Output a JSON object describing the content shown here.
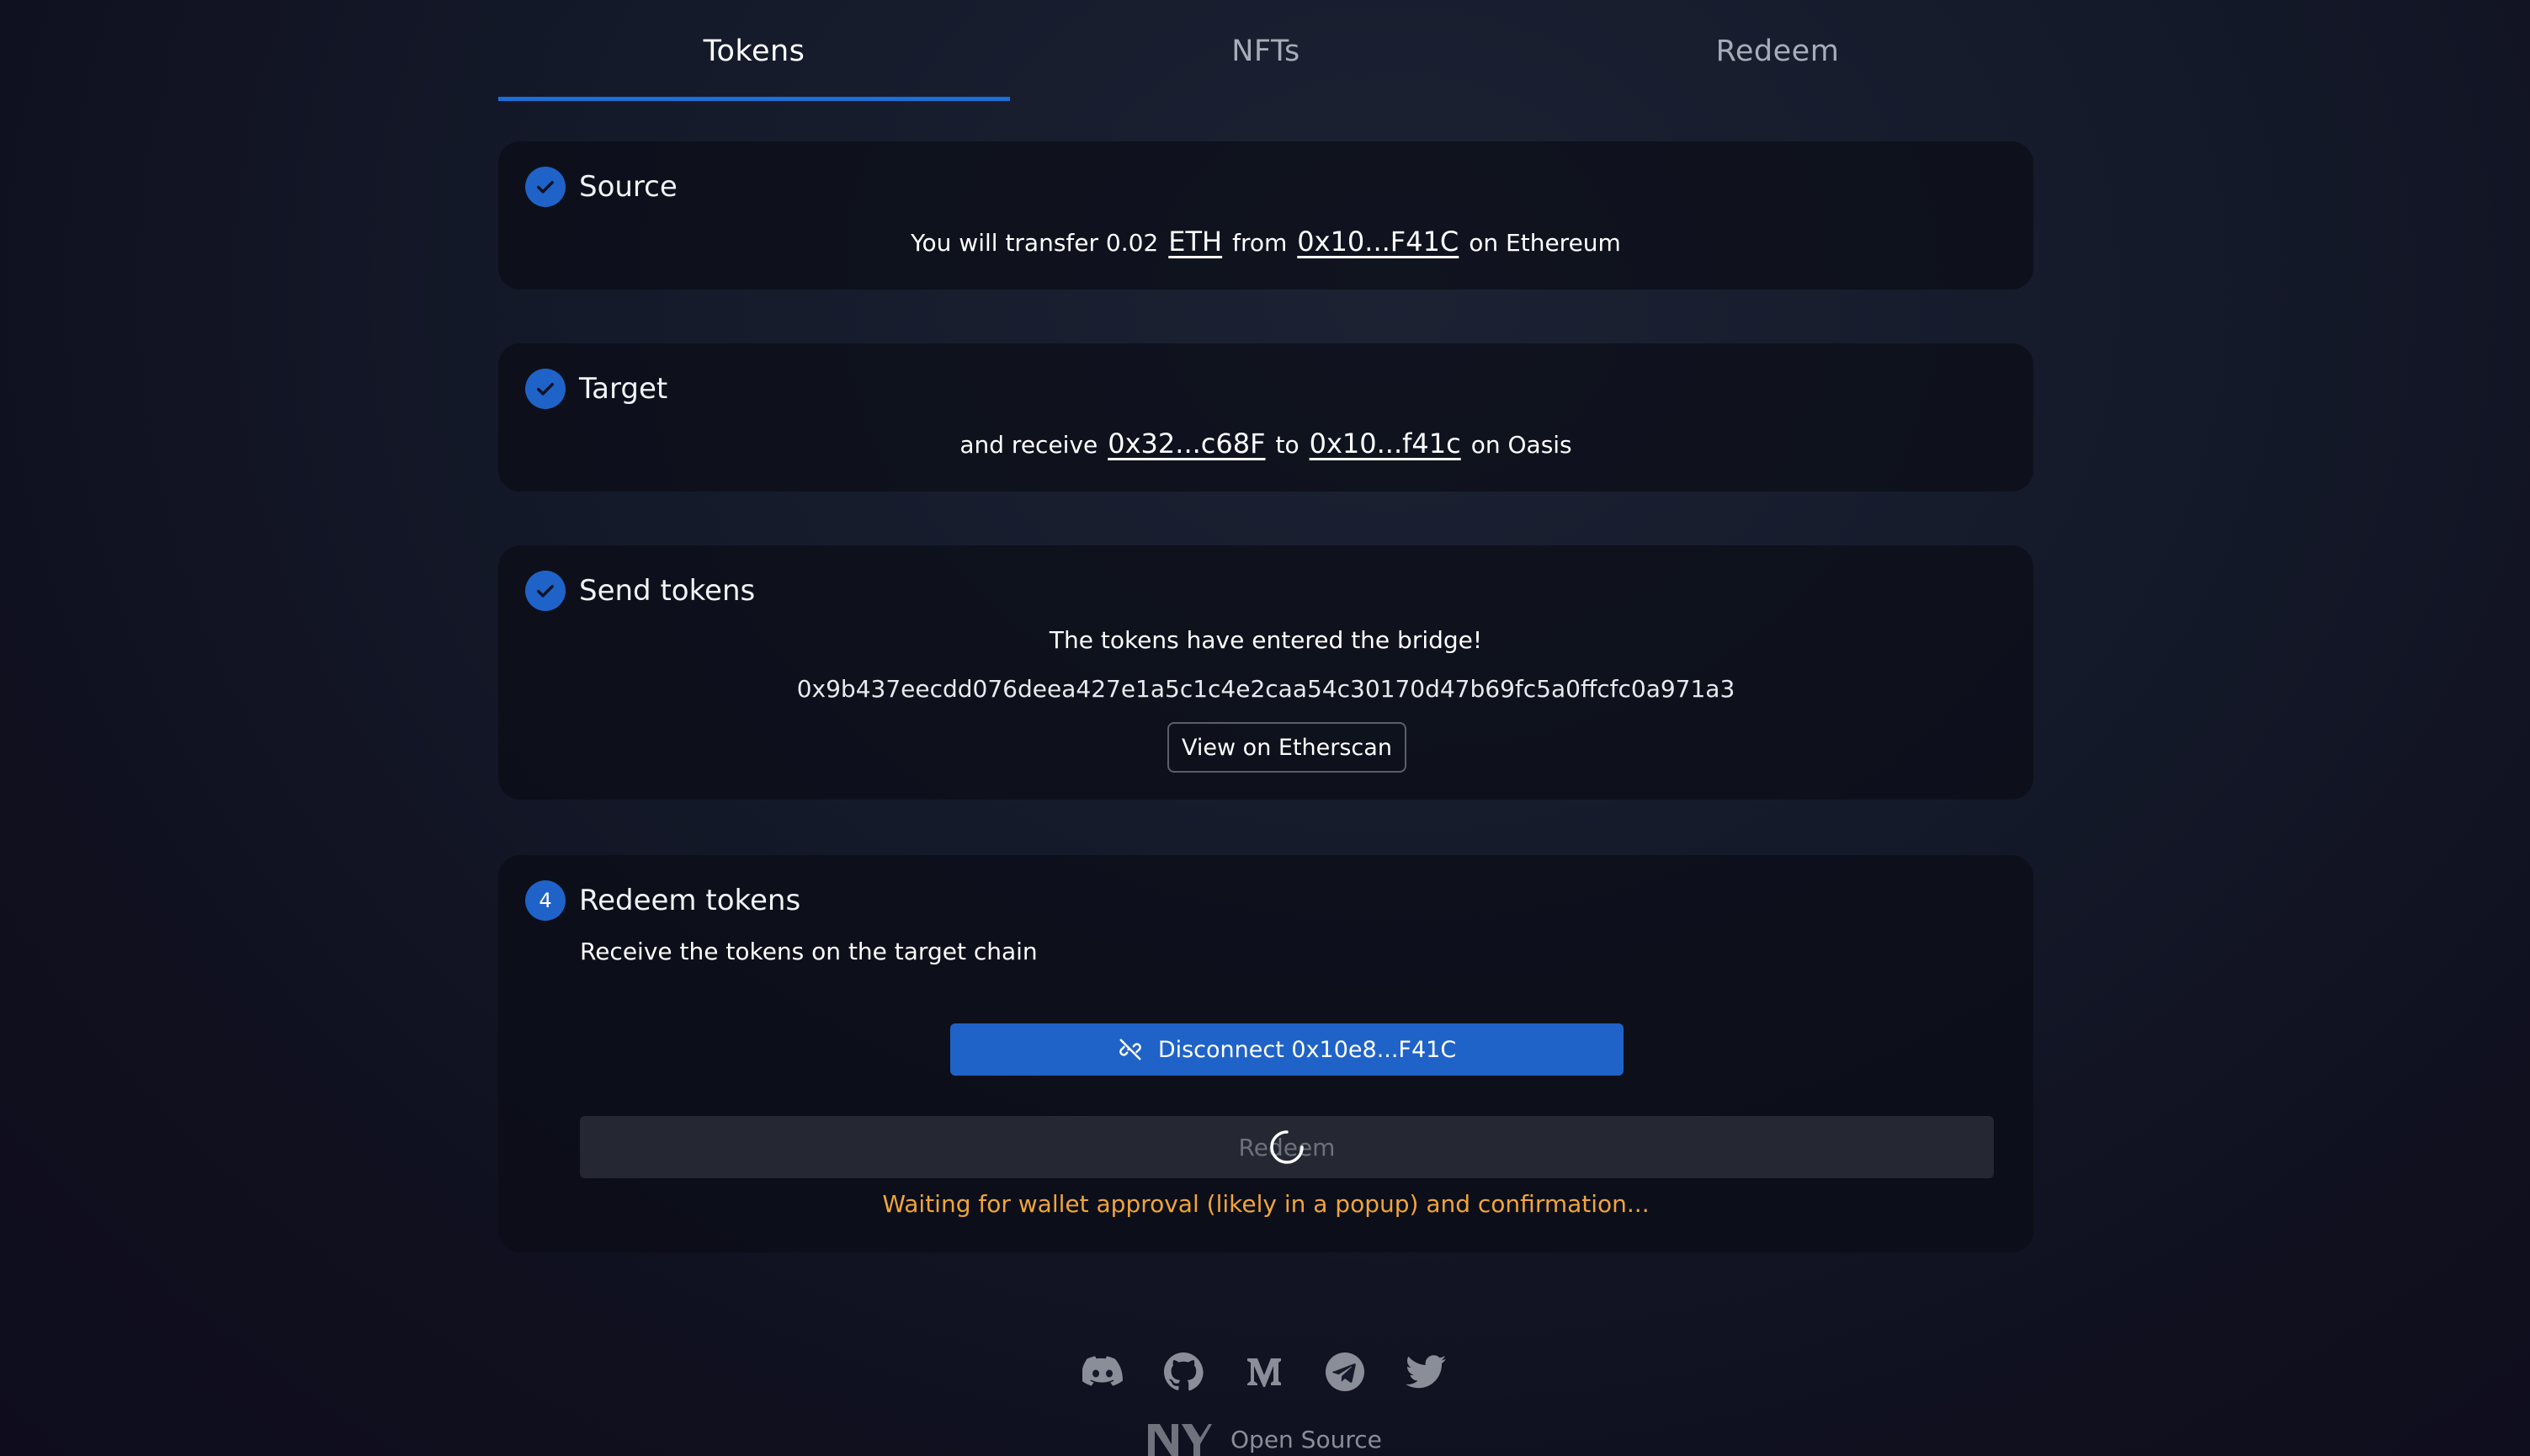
{
  "tabs": [
    {
      "label": "Tokens",
      "active": true
    },
    {
      "label": "NFTs",
      "active": false
    },
    {
      "label": "Redeem",
      "active": false
    }
  ],
  "source": {
    "title": "Source",
    "prefix": "You will transfer 0.02",
    "token": "ETH",
    "from_word": "from",
    "address": "0x10...F41C",
    "chain_text": "on Ethereum"
  },
  "target": {
    "title": "Target",
    "prefix": "and receive",
    "token_address": "0x32...c68F",
    "to_word": "to",
    "address": "0x10...f41c",
    "chain_text": "on Oasis"
  },
  "send": {
    "title": "Send tokens",
    "message": "The tokens have entered the bridge!",
    "tx_hash": "0x9b437eecdd076deea427e1a5c1c4e2caa54c30170d47b69fc5a0ffcfc0a971a3",
    "explorer_button": "View on Etherscan"
  },
  "redeem": {
    "step_number": "4",
    "title": "Redeem tokens",
    "subtitle": "Receive the tokens on the target chain",
    "disconnect_button": "Disconnect 0x10e8...F41C",
    "redeem_button": "Redeem",
    "status": "Waiting for wallet approval (likely in a popup) and confirmation..."
  },
  "footer": {
    "socials": [
      "discord-icon",
      "github-icon",
      "medium-icon",
      "telegram-icon",
      "twitter-icon"
    ],
    "brand_text": "Open Source"
  },
  "colors": {
    "accent": "#1f63c8",
    "warning": "#f1a537"
  }
}
